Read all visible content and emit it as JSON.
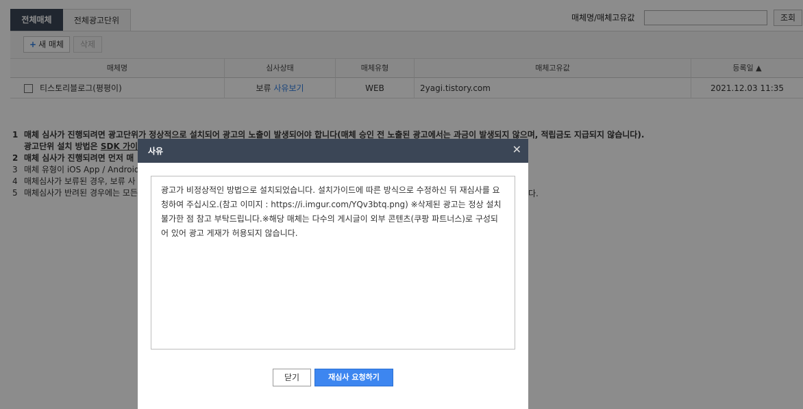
{
  "tabs": [
    {
      "label": "전체매체",
      "active": true
    },
    {
      "label": "전체광고단위",
      "active": false
    }
  ],
  "search": {
    "label": "매체명/매체고유값",
    "value": "",
    "placeholder": "",
    "button_label": "조회"
  },
  "toolbar": {
    "new_label": "새 매체",
    "delete_label": "삭제"
  },
  "table": {
    "headers": [
      "매체명",
      "심사상태",
      "매체유형",
      "매체고유값",
      "등록일 ▲"
    ],
    "rows": [
      {
        "name": "티스토리블로그(평평이)",
        "status": "보류",
        "status_link": "사유보기",
        "type": "WEB",
        "unique_value": "2yagi.tistory.com",
        "registered": "2021.12.03 11:35"
      }
    ]
  },
  "notes": [
    {
      "num": "1",
      "text": "매체 심사가 진행되려면 광고단위가 정상적으로 설치되어 광고의 노출이 발생되어야 합니다(매체 승인 전 노출된 광고에서는 과금이 발생되지 않으며, 적립금도 지급되지 않습니다)."
    },
    {
      "num": "",
      "text_prefix": "광고단위 설치 방법은 ",
      "link": "SDK 가이"
    },
    {
      "num": "2",
      "text": "매체 심사가 진행되려면 먼저 매"
    },
    {
      "num": "3",
      "text": "매체 유형이 iOS App / Android"
    },
    {
      "num": "4",
      "text": "매체심사가 보류된 경우, 보류 사"
    },
    {
      "num": "5",
      "text": "매체심사가 반려된 경우에는 모든",
      "tail": "다."
    }
  ],
  "modal": {
    "title": "사유",
    "reason_text": "광고가 비정상적인 방법으로 설치되었습니다. 설치가이드에 따른 방식으로 수정하신 뒤 재심사를 요청하여 주십시오.(참고 이미지 : https://i.imgur.com/YQv3btq.png) ※삭제된 광고는 정상 설치 불가한 점 참고 부탁드립니다.※해당 매체는 다수의 게시글이 외부 콘텐츠(쿠팡 파트너스)로 구성되어 있어 광고 게재가 허용되지 않습니다.",
    "close_label": "닫기",
    "rereview_label": "재심사 요청하기"
  }
}
